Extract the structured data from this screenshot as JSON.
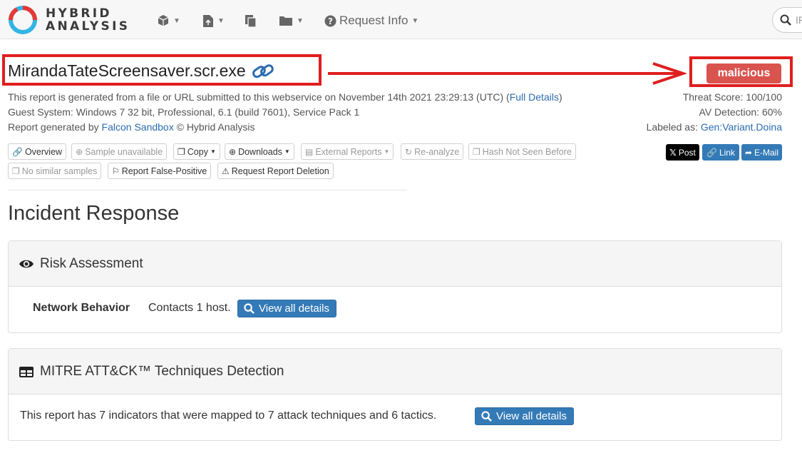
{
  "nav": {
    "logo_top": "HYBRID",
    "logo_bottom": "ANALYSIS",
    "request_info": "Request Info",
    "search_placeholder": "IP"
  },
  "report": {
    "filename": "MirandaTateScreensaver.scr.exe",
    "verdict": "malicious",
    "generated_prefix": "This report is generated from a file or URL submitted to this webservice on November 14th 2021 23:29:13 (UTC) (",
    "full_details": "Full Details",
    "generated_suffix": ")",
    "guest_system": "Guest System: Windows 7 32 bit, Professional, 6.1 (build 7601), Service Pack 1",
    "generated_by_prefix": "Report generated by ",
    "falcon_sandbox": "Falcon Sandbox",
    "generated_by_suffix": " © Hybrid Analysis",
    "threat_score": "Threat Score: 100/100",
    "av_detection": "AV Detection: 60%",
    "labeled_prefix": "Labeled as: ",
    "labeled_value": "Gen:Variant.Doina"
  },
  "actions": {
    "overview": "Overview",
    "sample_unavailable": "Sample unavailable",
    "copy": "Copy",
    "downloads": "Downloads",
    "external_reports": "External Reports",
    "reanalyze": "Re-analyze",
    "hash_not_seen": "Hash Not Seen Before",
    "no_similar": "No similar samples",
    "report_false_positive": "Report False-Positive",
    "request_deletion": "Request Report Deletion"
  },
  "share": {
    "post": "Post",
    "link": "Link",
    "email": "E-Mail"
  },
  "incident": {
    "heading": "Incident Response",
    "risk_title": "Risk Assessment",
    "network_label": "Network Behavior",
    "network_text": "Contacts 1 host.",
    "view_all": "View all details",
    "mitre_title": "MITRE ATT&CK™ Techniques Detection",
    "mitre_text": "This report has 7 indicators that were mapped to 7 attack techniques and 6 tactics."
  },
  "colors": {
    "accent_blue": "#337ab7",
    "malicious_red": "#d9534f",
    "annotation_red": "#e01e1e"
  }
}
